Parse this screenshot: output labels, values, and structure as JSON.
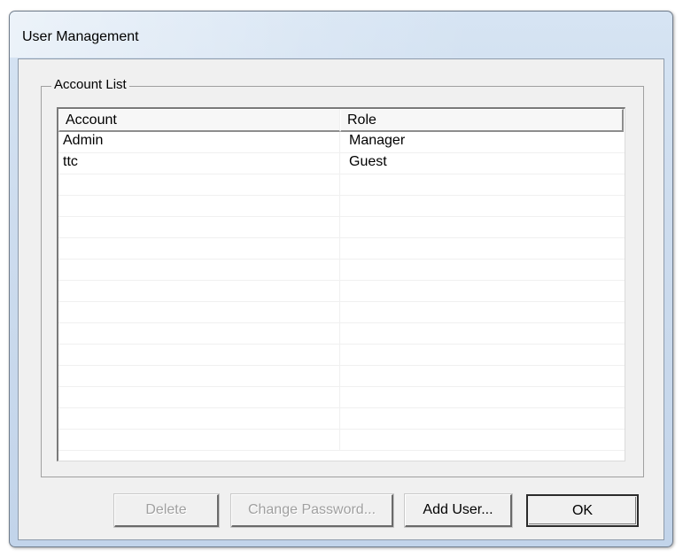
{
  "window": {
    "title": "User Management"
  },
  "group": {
    "label": "Account List"
  },
  "list": {
    "columns": [
      "Account",
      "Role"
    ],
    "rows": [
      [
        "Admin",
        "Manager"
      ],
      [
        "ttc",
        "Guest"
      ],
      [
        "",
        ""
      ],
      [
        "",
        ""
      ],
      [
        "",
        ""
      ],
      [
        "",
        ""
      ],
      [
        "",
        ""
      ],
      [
        "",
        ""
      ],
      [
        "",
        ""
      ],
      [
        "",
        ""
      ],
      [
        "",
        ""
      ],
      [
        "",
        ""
      ],
      [
        "",
        ""
      ],
      [
        "",
        ""
      ],
      [
        "",
        ""
      ]
    ]
  },
  "buttons": {
    "delete": "Delete",
    "change_password": "Change Password...",
    "add_user": "Add User...",
    "ok": "OK"
  },
  "colors": {
    "frame": "#cddcee",
    "client": "#f0f0f0",
    "disabled_text": "#a0a0a0"
  }
}
